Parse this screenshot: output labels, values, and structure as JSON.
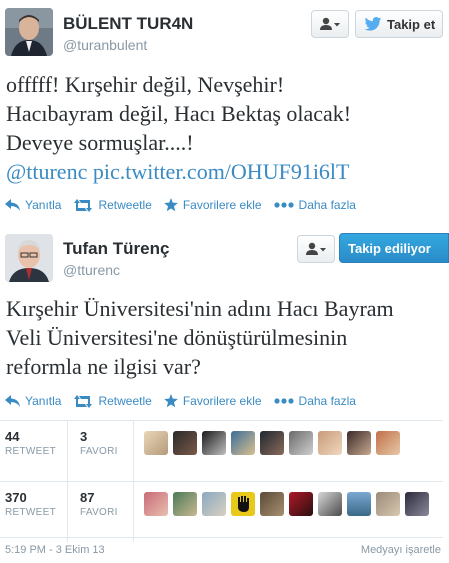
{
  "tweet1": {
    "display_name": "BÜLENT TUR4N",
    "handle": "@turanbulent",
    "follow_label": "Takip et",
    "text_lines": [
      "offfff! Kırşehir değil, Nevşehir!",
      "Hacıbayram değil, Hacı Bektaş olacak!",
      "Deveye sormuşlar....!"
    ],
    "mention": "@tturenc",
    "pic_link": "pic.twitter.com/OHUF91i6lT",
    "actions": {
      "reply": "Yanıtla",
      "retweet": "Retweetle",
      "favorite": "Favorilere ekle",
      "more": "Daha fazla"
    }
  },
  "tweet2": {
    "display_name": "Tufan Türenç",
    "handle": "@tturenc",
    "following_label": "Takip ediliyor",
    "text_lines": [
      "Kırşehir Üniversitesi'nin adını Hacı Bayram",
      "Veli Üniversitesi'ne dönüştürülmesinin",
      "reformla ne ilgisi var?"
    ],
    "actions": {
      "reply": "Yanıtla",
      "retweet": "Retweetle",
      "favorite": "Favorilere ekle",
      "more": "Daha fazla"
    }
  },
  "stats1": {
    "retweets": "44",
    "retweets_label": "RETWEET",
    "favorites": "3",
    "favorites_label": "FAVORI"
  },
  "stats2": {
    "retweets": "370",
    "retweets_label": "RETWEET",
    "favorites": "87",
    "favorites_label": "FAVORI"
  },
  "footer": {
    "timestamp": "5:19 PM - 3 Ekim 13",
    "flag_media": "Medyayı işaretle"
  },
  "colors": {
    "link": "#3a8bc4",
    "follow_blue": "#2a8cc8",
    "muted": "#8899a6"
  }
}
